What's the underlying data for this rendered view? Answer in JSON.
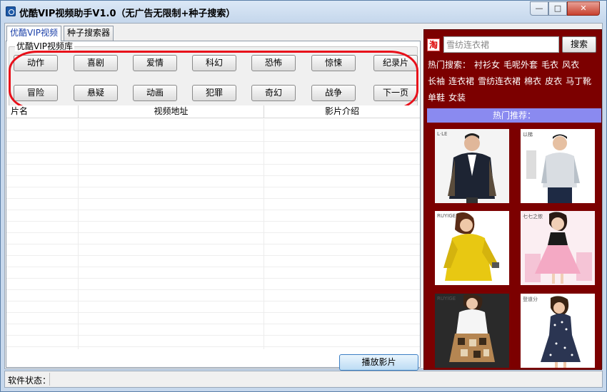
{
  "window": {
    "title": "优酷VIP视频助手V1.0（无广告无限制+种子搜索）",
    "controls": {
      "minimize": "—",
      "maximize": "□",
      "close": "✕"
    }
  },
  "tabs": [
    {
      "label": "优酷VIP视频",
      "active": true
    },
    {
      "label": "种子搜索器",
      "active": false
    }
  ],
  "library": {
    "title": "优酷VIP视频库",
    "categories": [
      "动作",
      "喜剧",
      "爱情",
      "科幻",
      "恐怖",
      "惊悚",
      "纪录片",
      "冒险",
      "悬疑",
      "动画",
      "犯罪",
      "奇幻",
      "战争",
      "下一页"
    ]
  },
  "table": {
    "columns": [
      "片名",
      "视频地址",
      "影片介绍"
    ],
    "rows": []
  },
  "play_button": "播放影片",
  "right_panel": {
    "search_placeholder": "雪纺连衣裙",
    "search_button": "搜索",
    "hot_search_label": "热门搜索：",
    "hot_search_items": [
      "衬衫女",
      "毛呢外套",
      "毛衣",
      "风衣",
      "长袖",
      "连衣裙",
      "雪纺连衣裙",
      "棉衣",
      "皮衣",
      "马丁靴",
      "单鞋",
      "女装"
    ],
    "hot_recommend_label": "热门推荐：",
    "products": [
      {
        "brand": "L·LE",
        "icon": "jacket-image"
      },
      {
        "brand": "以梯",
        "icon": "shirt-image"
      },
      {
        "brand": "RUYIGE",
        "icon": "yellow-dress-image"
      },
      {
        "brand": "七七之侬",
        "icon": "pink-dress-image"
      },
      {
        "brand": "RUYIGE",
        "icon": "printed-skirt-image"
      },
      {
        "brand": "登道分",
        "icon": "dot-dress-image"
      }
    ]
  },
  "statusbar": {
    "label": "软件状态："
  },
  "colors": {
    "panel_bg": "#7c0000",
    "highlight": "#e8101a",
    "accent": "#8a8af0"
  }
}
